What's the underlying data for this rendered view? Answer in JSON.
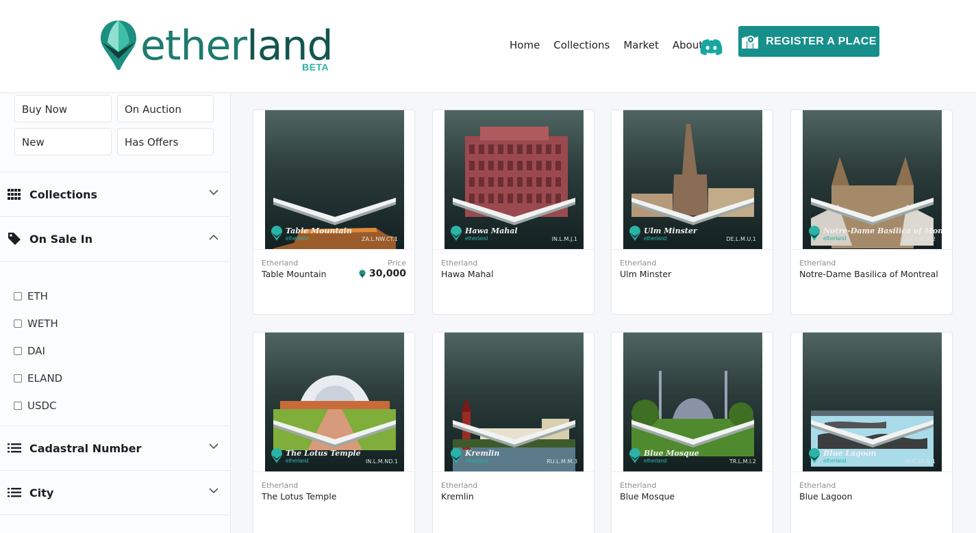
{
  "header": {
    "logo_word_a": "ether",
    "logo_word_b": "land",
    "logo_badge": "BETA",
    "nav": [
      "Home",
      "Collections",
      "Market",
      "About"
    ],
    "register_label": "REGISTER A PLACE",
    "accent": "#178f8a"
  },
  "sidebar": {
    "status_buttons": [
      "Buy Now",
      "On Auction",
      "New",
      "Has Offers"
    ],
    "sections": {
      "collections": "Collections",
      "on_sale_in": "On Sale In",
      "cadastral": "Cadastral Number",
      "city": "City"
    },
    "currencies": [
      "ETH",
      "WETH",
      "DAI",
      "ELAND",
      "USDC"
    ]
  },
  "cards": [
    {
      "collection": "Etherland",
      "name": "Table Mountain",
      "code": "ZA.L.NW.CT.1",
      "price_label": "Price",
      "price": "30,000"
    },
    {
      "collection": "Etherland",
      "name": "Hawa Mahal",
      "code": "IN.L.M.J.1"
    },
    {
      "collection": "Etherland",
      "name": "Ulm Minster",
      "code": "DE.L.M.U.1"
    },
    {
      "collection": "Etherland",
      "name": "Notre-Dame Basilica of Montreal",
      "code": "CA.L.M.M.2"
    },
    {
      "collection": "Etherland",
      "name": "The Lotus Temple",
      "code": "IN.L.M.ND.1"
    },
    {
      "collection": "Etherland",
      "name": "Kremlin",
      "code": "RU.L.M.M.3"
    },
    {
      "collection": "Etherland",
      "name": "Blue Mosque",
      "code": "TR.L.M.I.2"
    },
    {
      "collection": "Etherland",
      "name": "Blue Lagoon",
      "code": "IS.C.LE.G.1"
    }
  ],
  "thumb_titles": [
    "Table Mountain",
    "Hawa Mahal",
    "Ulm Minster",
    "Notre-Dame Basilica of Montreal",
    "The Lotus Temple",
    "Kremlin",
    "Blue Mosque",
    "Blue Lagoon"
  ],
  "thumb_brand": "etherland",
  "icons": {
    "register": "map-pin-icon",
    "discord": "discord-icon",
    "collections": "grid-icon",
    "on_sale_in": "tag-icon",
    "cadastral": "list-icon",
    "city": "list-icon",
    "price_currency": "eland-token-icon"
  }
}
